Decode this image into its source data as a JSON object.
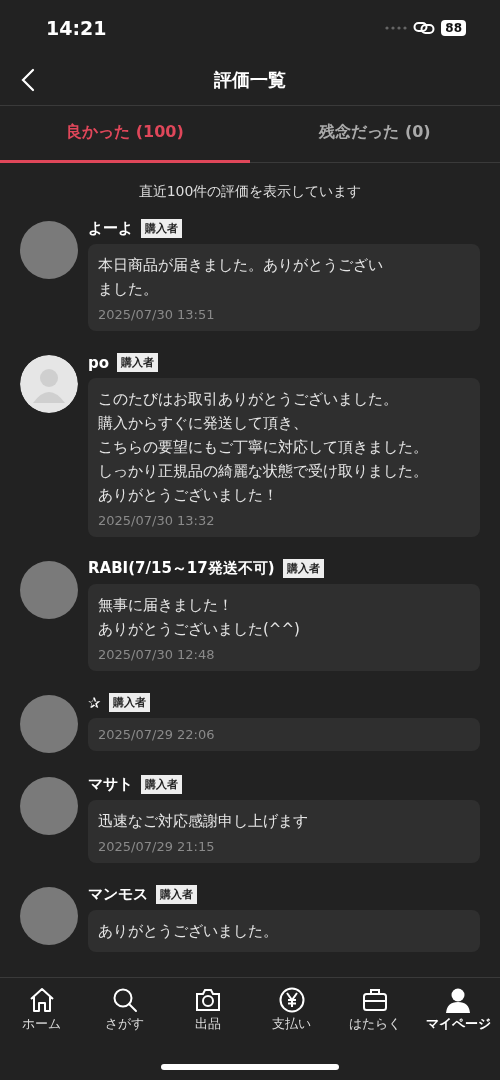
{
  "status_bar": {
    "time": "14:21",
    "battery": "88"
  },
  "header": {
    "title": "評価一覧"
  },
  "tabs": [
    {
      "label": "良かった (100)",
      "selected": true
    },
    {
      "label": "残念だった (0)",
      "selected": false
    }
  ],
  "notice": "直近100件の評価を表示しています",
  "reviews": [
    {
      "kind": "photo",
      "name": "よーよ",
      "badge": "購入者",
      "lines": [
        "本日商品が届きました。ありがとうござい",
        "ました。"
      ],
      "date": "2025/07/30 13:51"
    },
    {
      "kind": "default",
      "name": "po",
      "badge": "購入者",
      "lines": [
        "このたびはお取引ありがとうございました。",
        "購入からすぐに発送して頂き、",
        "こちらの要望にもご丁寧に対応して頂きました。",
        "しっかり正規品の綺麗な状態で受け取りました。",
        "ありがとうございました！"
      ],
      "date": "2025/07/30 13:32"
    },
    {
      "kind": "photo",
      "name": "RABI(7/15～17発送不可)",
      "badge": "購入者",
      "lines": [
        "無事に届きました！",
        "ありがとうございました(^^)"
      ],
      "date": "2025/07/30 12:48"
    },
    {
      "kind": "photo",
      "name": "✰",
      "badge": "購入者",
      "date": "2025/07/29 22:06"
    },
    {
      "kind": "photo",
      "name": "マサト",
      "badge": "購入者",
      "lines": [
        "迅速なご対応感謝申し上げます"
      ],
      "date": "2025/07/29 21:15"
    },
    {
      "kind": "photo",
      "name": "マンモス",
      "badge": "購入者",
      "lines": [
        "ありがとうございました。"
      ]
    }
  ],
  "nav": [
    {
      "label": "ホーム",
      "selected": false
    },
    {
      "label": "さがす",
      "selected": false
    },
    {
      "label": "出品",
      "selected": false
    },
    {
      "label": "支払い",
      "selected": false
    },
    {
      "label": "はたらく",
      "selected": false
    },
    {
      "label": "マイページ",
      "selected": true
    }
  ]
}
